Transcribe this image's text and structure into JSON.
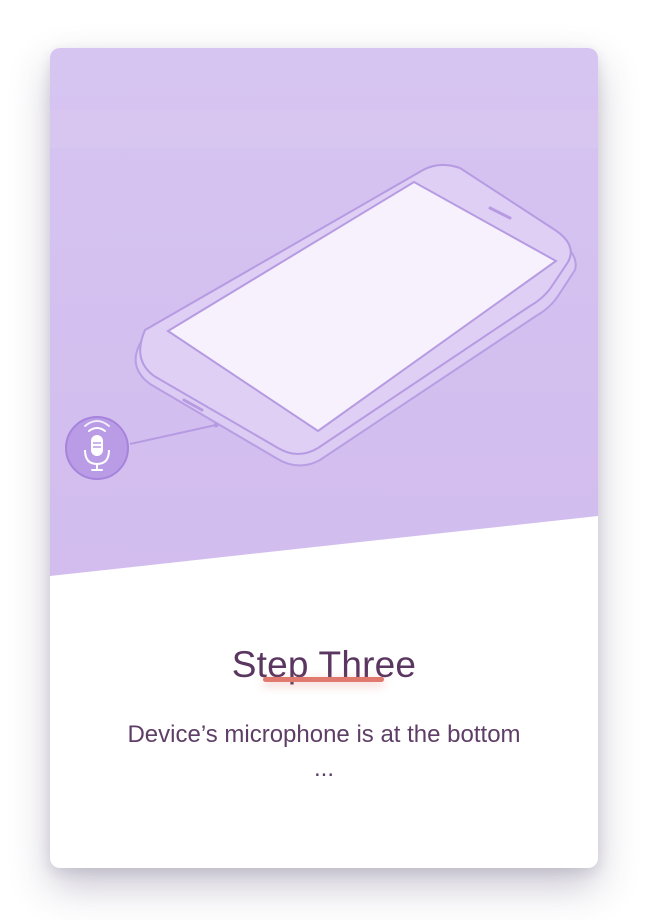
{
  "step": {
    "title": "Step Three",
    "description": "Device’s microphone is at the bottom ..."
  },
  "illustration": {
    "device": "smartphone",
    "icon": "microphone-icon"
  },
  "colors": {
    "hero_background": "#d5c2f0",
    "title_text": "#5a3660",
    "body_text": "#5e3e66",
    "accent_divider": "#e07a6e",
    "card_background": "#ffffff"
  }
}
